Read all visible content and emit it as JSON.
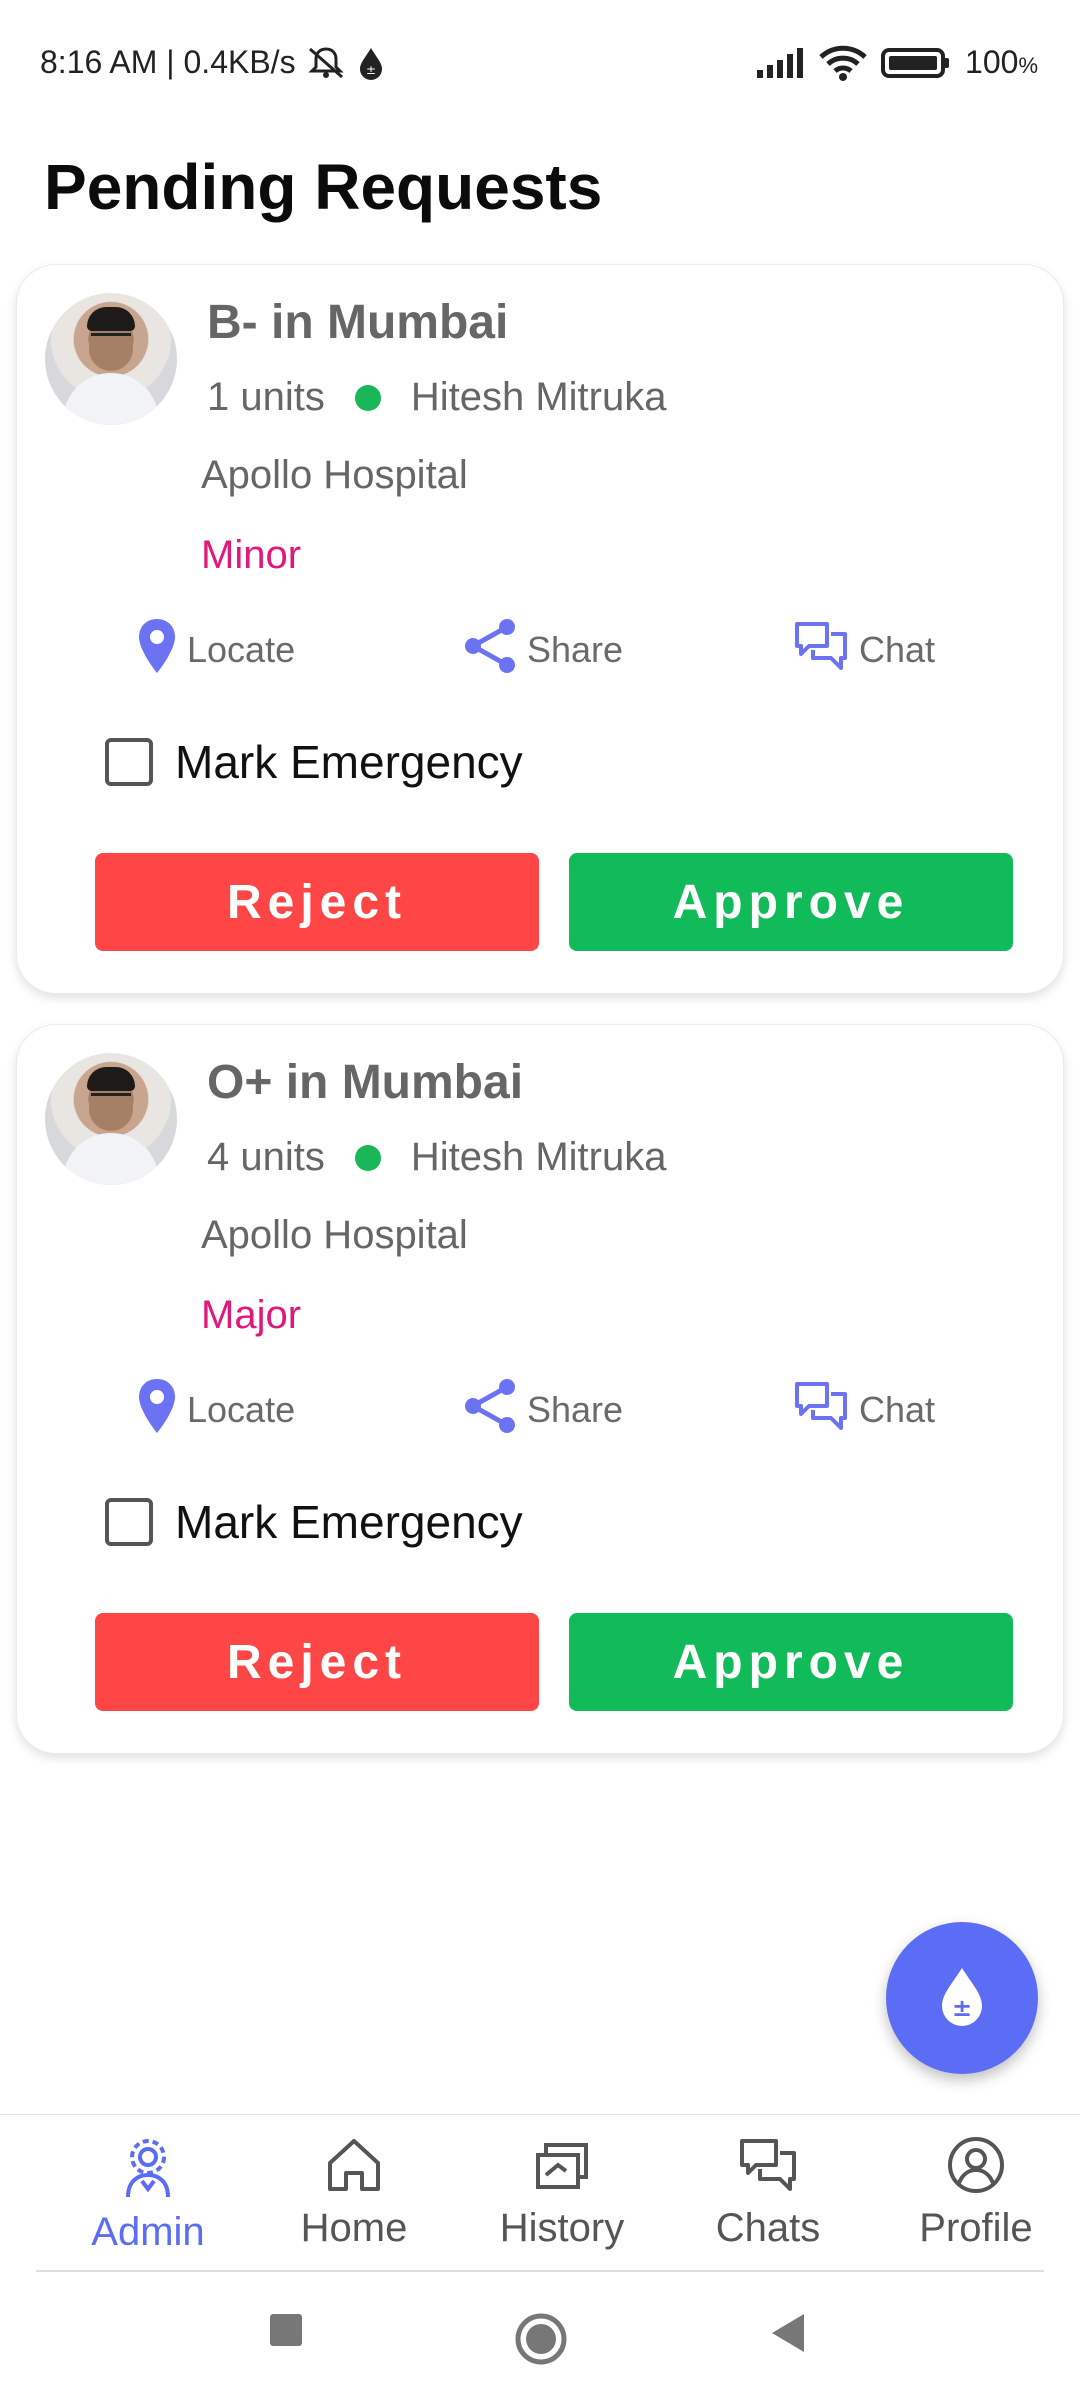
{
  "status_bar": {
    "time_speed": "8:16 AM | 0.4KB/s",
    "battery": "100"
  },
  "page_title": "Pending Requests",
  "requests": [
    {
      "blood_title": "B- in Mumbai",
      "units": "1 units",
      "requester": "Hitesh Mitruka",
      "hospital": "Apollo Hospital",
      "severity": "Minor",
      "locate_label": "Locate",
      "share_label": "Share",
      "chat_label": "Chat",
      "emergency_label": "Mark Emergency",
      "reject_label": "Reject",
      "approve_label": "Approve"
    },
    {
      "blood_title": "O+ in Mumbai",
      "units": "4 units",
      "requester": "Hitesh Mitruka",
      "hospital": "Apollo Hospital",
      "severity": "Major",
      "locate_label": "Locate",
      "share_label": "Share",
      "chat_label": "Chat",
      "emergency_label": "Mark Emergency",
      "reject_label": "Reject",
      "approve_label": "Approve"
    }
  ],
  "fab": {
    "icon": "blood-drop-plus-minus-icon"
  },
  "bottom_nav": {
    "items": [
      {
        "label": "Admin",
        "icon": "admin-gear-person-icon",
        "active": true
      },
      {
        "label": "Home",
        "icon": "home-icon",
        "active": false
      },
      {
        "label": "History",
        "icon": "history-icon",
        "active": false
      },
      {
        "label": "Chats",
        "icon": "chats-icon",
        "active": false
      },
      {
        "label": "Profile",
        "icon": "profile-icon",
        "active": false
      }
    ]
  },
  "colors": {
    "accent": "#5b6cf5",
    "reject": "#ff4646",
    "approve": "#12bb5a",
    "severity": "#e0187a",
    "status_dot": "#19b758"
  }
}
